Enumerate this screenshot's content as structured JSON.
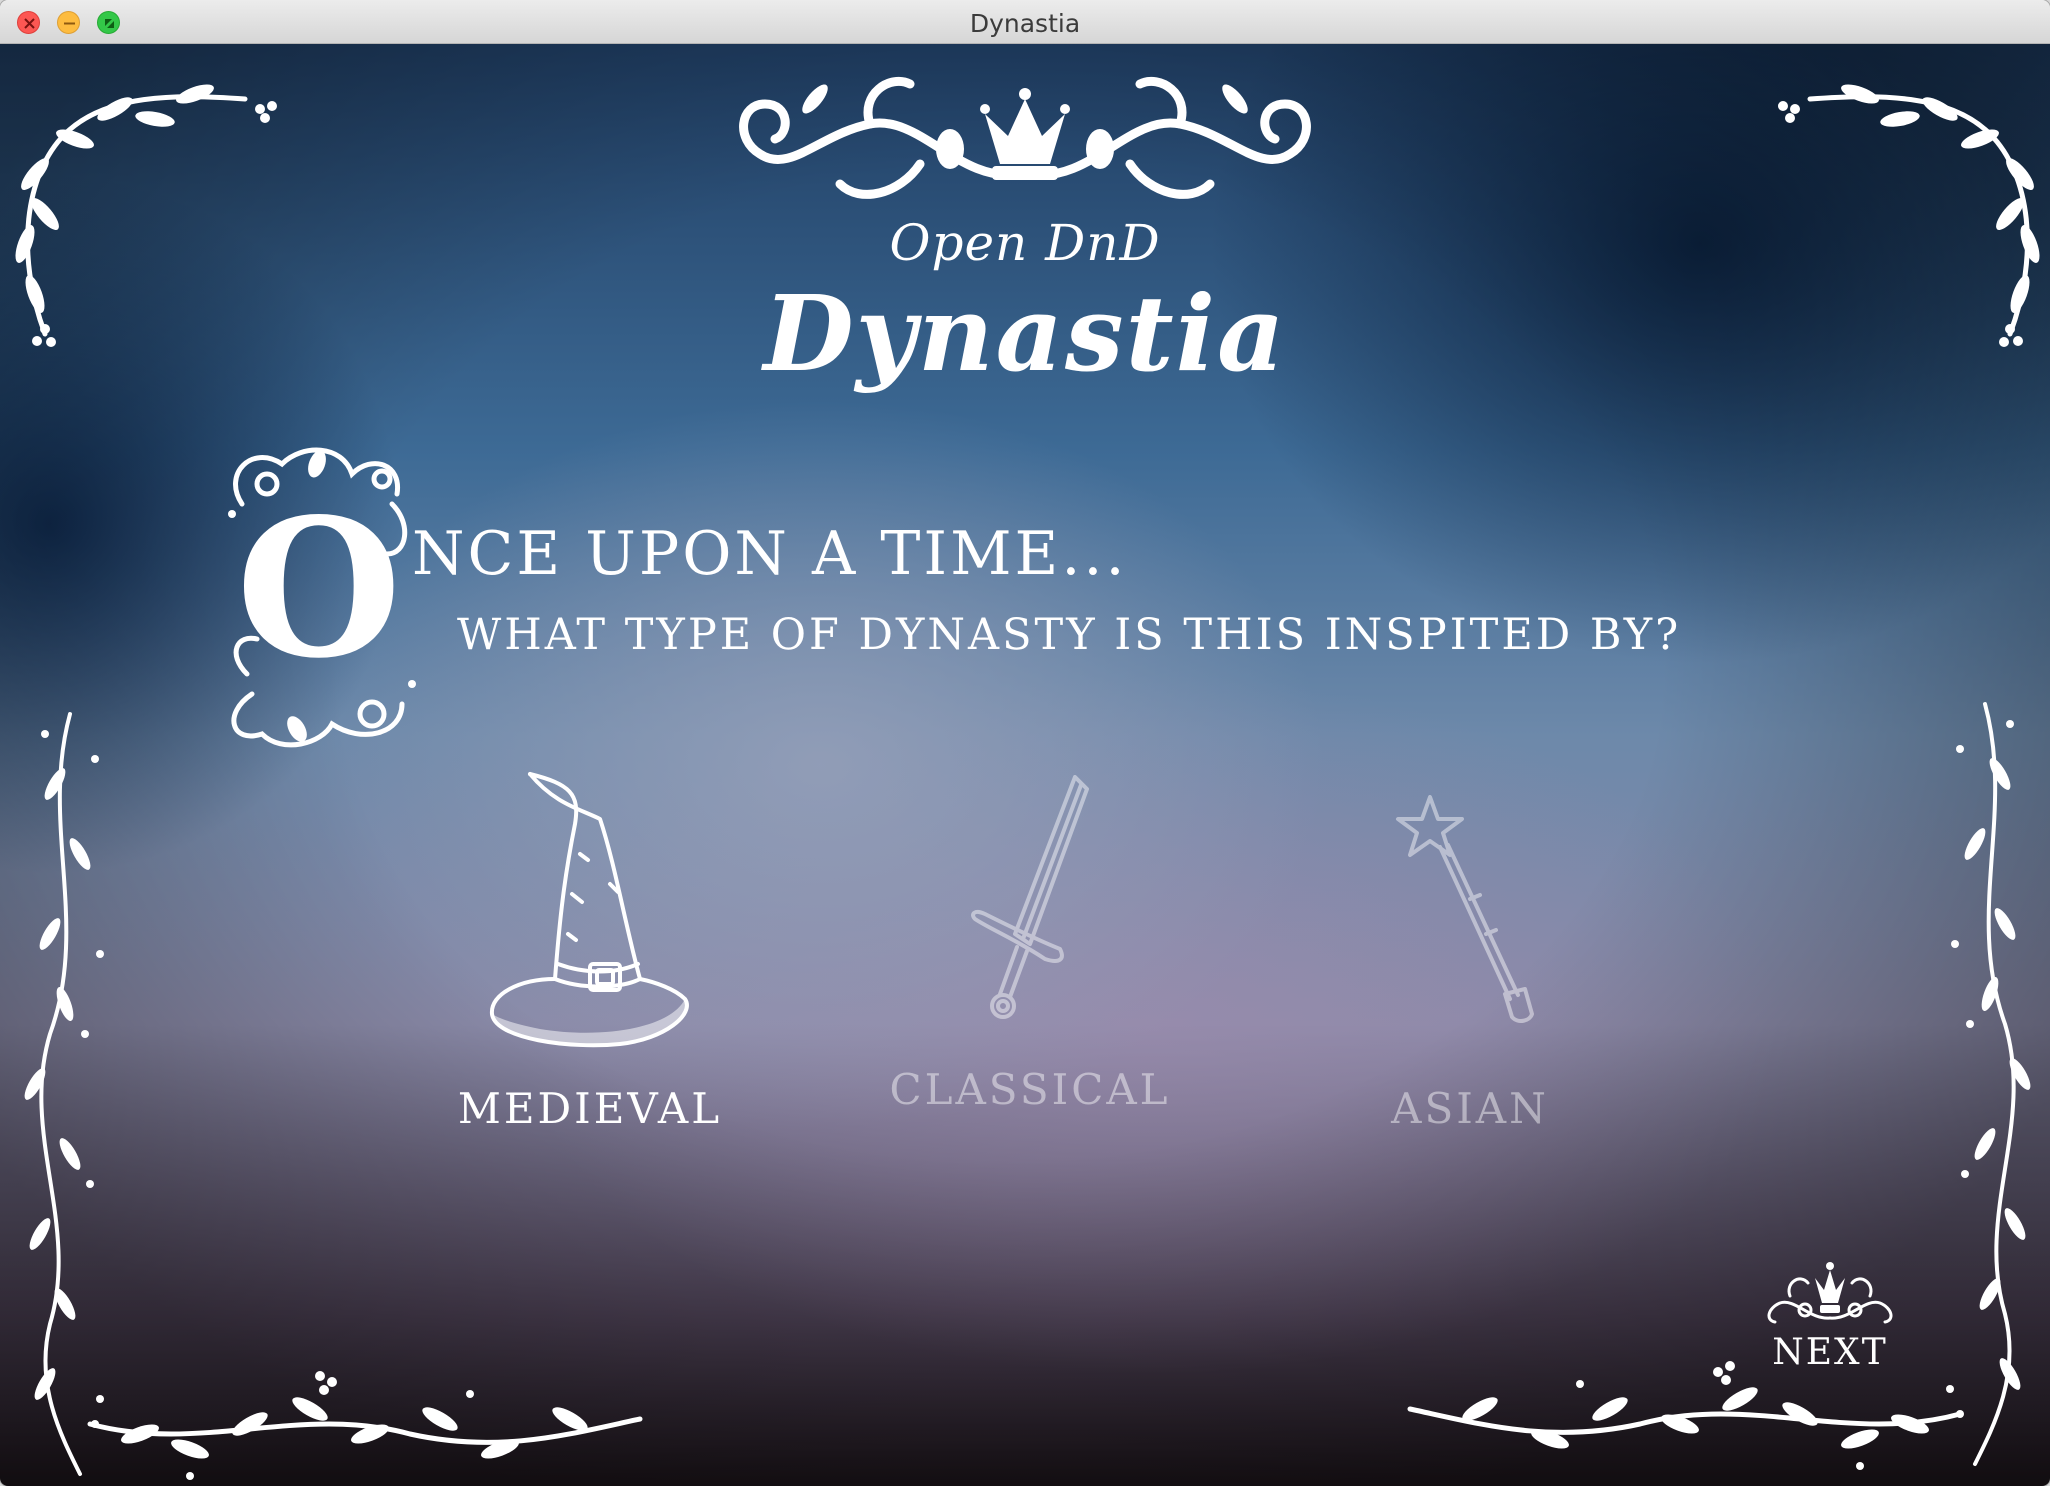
{
  "window": {
    "title": "Dynastia"
  },
  "header": {
    "subtitle": "Open DnD",
    "title": "Dynastia"
  },
  "prompt": {
    "dropcap": "O",
    "line1": "NCE UPON A TIME...",
    "line2": "WHAT TYPE OF DYNASTY IS THIS INSPITED BY?"
  },
  "options": [
    {
      "label": "MEDIEVAL",
      "icon": "wizard-hat-icon",
      "selected": true
    },
    {
      "label": "CLASSICAL",
      "icon": "sword-icon",
      "selected": false
    },
    {
      "label": "ASIAN",
      "icon": "star-wand-icon",
      "selected": false
    }
  ],
  "next": {
    "label": "NEXT",
    "icon": "crown-ornament-icon"
  },
  "colors": {
    "text": "#ffffff",
    "close": "#fc5753",
    "minimize": "#fdbc40",
    "maximize": "#33c748"
  }
}
